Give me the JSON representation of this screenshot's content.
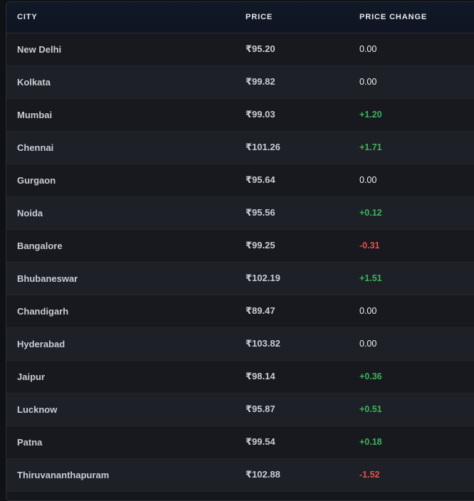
{
  "table": {
    "headers": {
      "city": "CITY",
      "price": "PRICE",
      "change": "PRICE CHANGE"
    },
    "rows": [
      {
        "city": "New Delhi",
        "price": "₹95.20",
        "change": "0.00",
        "trend": "flat"
      },
      {
        "city": "Kolkata",
        "price": "₹99.82",
        "change": "0.00",
        "trend": "flat"
      },
      {
        "city": "Mumbai",
        "price": "₹99.03",
        "change": "+1.20",
        "trend": "up"
      },
      {
        "city": "Chennai",
        "price": "₹101.26",
        "change": "+1.71",
        "trend": "up"
      },
      {
        "city": "Gurgaon",
        "price": "₹95.64",
        "change": "0.00",
        "trend": "flat"
      },
      {
        "city": "Noida",
        "price": "₹95.56",
        "change": "+0.12",
        "trend": "up"
      },
      {
        "city": "Bangalore",
        "price": "₹99.25",
        "change": "-0.31",
        "trend": "down"
      },
      {
        "city": "Bhubaneswar",
        "price": "₹102.19",
        "change": "+1.51",
        "trend": "up"
      },
      {
        "city": "Chandigarh",
        "price": "₹89.47",
        "change": "0.00",
        "trend": "flat"
      },
      {
        "city": "Hyderabad",
        "price": "₹103.82",
        "change": "0.00",
        "trend": "flat"
      },
      {
        "city": "Jaipur",
        "price": "₹98.14",
        "change": "+0.36",
        "trend": "up"
      },
      {
        "city": "Lucknow",
        "price": "₹95.87",
        "change": "+0.51",
        "trend": "up"
      },
      {
        "city": "Patna",
        "price": "₹99.54",
        "change": "+0.18",
        "trend": "up"
      },
      {
        "city": "Thiruvananthapuram",
        "price": "₹102.88",
        "change": "-1.52",
        "trend": "down"
      }
    ]
  },
  "colors": {
    "positive": "#3fb25a",
    "negative": "#e8524b",
    "neutral": "#f2f3f5"
  }
}
